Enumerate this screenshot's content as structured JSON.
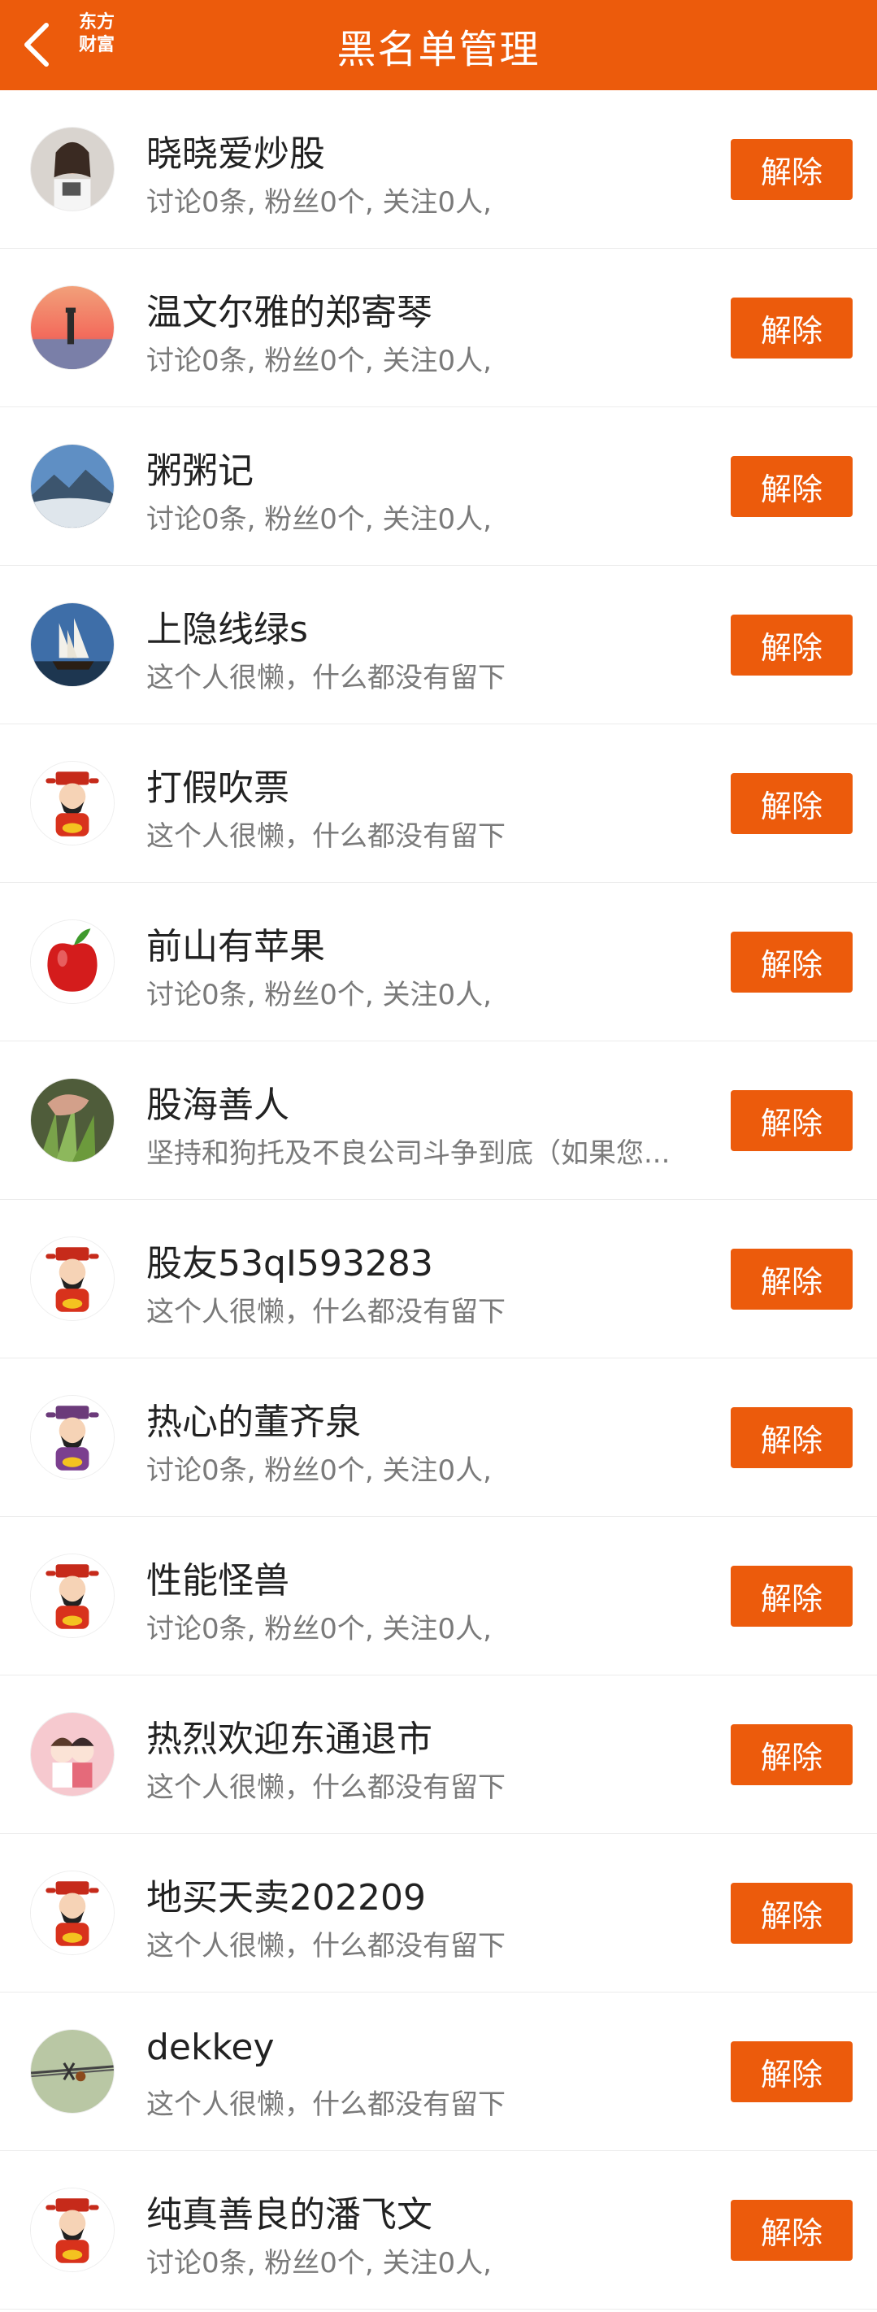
{
  "header": {
    "title": "黑名单管理",
    "logo_line1": "东方",
    "logo_line2": "财富"
  },
  "colors": {
    "accent": "#ec5b0c",
    "name_text": "#222222",
    "desc_text": "#7a7a7a"
  },
  "items": [
    {
      "name": "晓晓爱炒股",
      "desc": "讨论0条, 粉丝0个, 关注0人,",
      "action": "解除",
      "avatar": "photo-avatar"
    },
    {
      "name": "温文尔雅的郑寄琴",
      "desc": "讨论0条, 粉丝0个, 关注0人,",
      "action": "解除",
      "avatar": "sunset-lighthouse-avatar"
    },
    {
      "name": "粥粥记",
      "desc": "讨论0条, 粉丝0个, 关注0人,",
      "action": "解除",
      "avatar": "mountain-avatar"
    },
    {
      "name": "上隐线绿s",
      "desc": "这个人很懒，什么都没有留下",
      "action": "解除",
      "avatar": "sailing-ship-avatar"
    },
    {
      "name": "打假吹票",
      "desc": "这个人很懒，什么都没有留下",
      "action": "解除",
      "avatar": "fortune-god-avatar"
    },
    {
      "name": "前山有苹果",
      "desc": "讨论0条, 粉丝0个, 关注0人,",
      "action": "解除",
      "avatar": "apple-avatar"
    },
    {
      "name": "股海善人",
      "desc": "坚持和狗托及不良公司斗争到底（如果您...",
      "action": "解除",
      "avatar": "plant-hand-avatar"
    },
    {
      "name": "股友53qI593283",
      "desc": "这个人很懒，什么都没有留下",
      "action": "解除",
      "avatar": "fortune-god-avatar"
    },
    {
      "name": "热心的董齐泉",
      "desc": "讨论0条, 粉丝0个, 关注0人,",
      "action": "解除",
      "avatar": "fortune-god-purple-avatar"
    },
    {
      "name": "性能怪兽",
      "desc": "讨论0条, 粉丝0个, 关注0人,",
      "action": "解除",
      "avatar": "fortune-god-avatar"
    },
    {
      "name": "热烈欢迎东通退市",
      "desc": "这个人很懒，什么都没有留下",
      "action": "解除",
      "avatar": "cartoon-couple-avatar"
    },
    {
      "name": "地买天卖202209",
      "desc": "这个人很懒，什么都没有留下",
      "action": "解除",
      "avatar": "fortune-god-avatar"
    },
    {
      "name": "dekkey",
      "desc": "这个人很懒，什么都没有留下",
      "action": "解除",
      "avatar": "barbed-wire-avatar"
    },
    {
      "name": "纯真善良的潘飞文",
      "desc": "讨论0条, 粉丝0个, 关注0人,",
      "action": "解除",
      "avatar": "fortune-god-avatar"
    }
  ]
}
